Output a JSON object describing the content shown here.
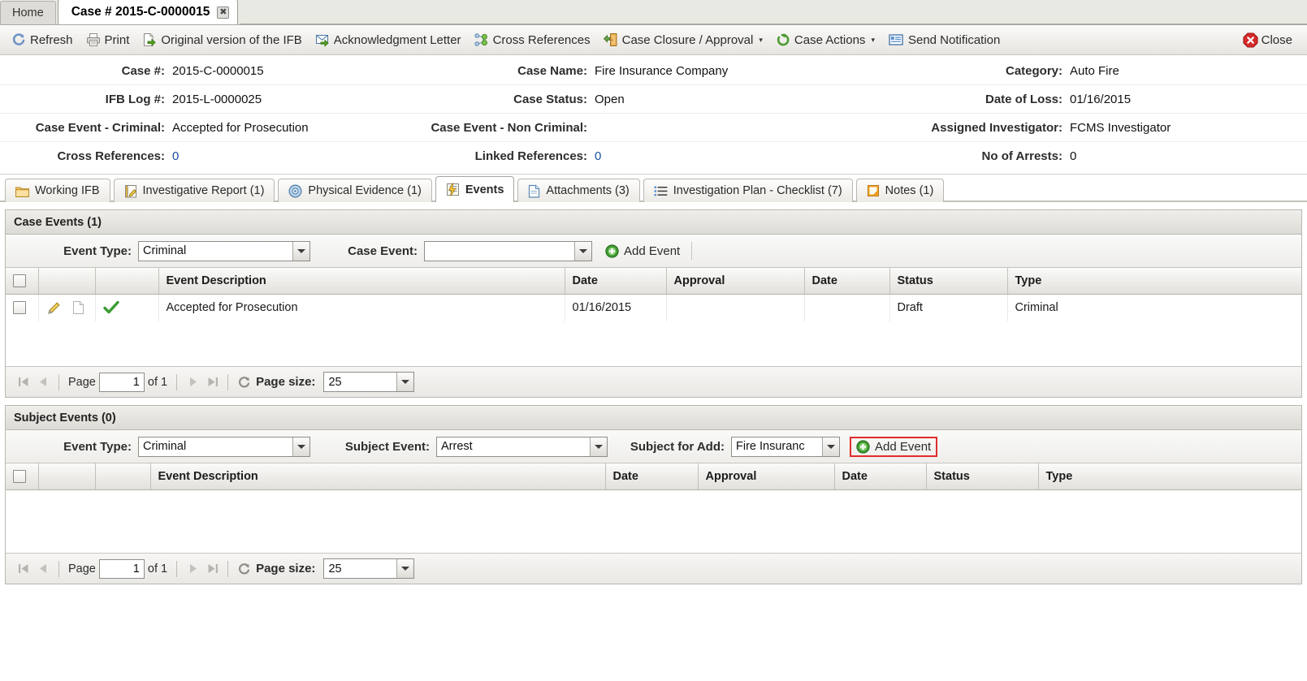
{
  "window_tabs": [
    {
      "label": "Home",
      "active": false,
      "closable": false
    },
    {
      "label": "Case # 2015-C-0000015",
      "active": true,
      "closable": true,
      "close_glyph": "✖"
    }
  ],
  "toolbar": {
    "items": [
      {
        "label": "Refresh",
        "icon": "refresh-icon"
      },
      {
        "label": "Print",
        "icon": "printer-icon"
      },
      {
        "label": "Original version of the IFB",
        "icon": "document-export-icon"
      },
      {
        "label": "Acknowledgment Letter",
        "icon": "envelope-export-icon"
      },
      {
        "label": "Cross References",
        "icon": "network-nodes-icon"
      },
      {
        "label": "Case Closure / Approval",
        "icon": "door-exit-icon",
        "dropdown": true
      },
      {
        "label": "Case Actions",
        "icon": "arrow-refresh-icon",
        "dropdown": true
      },
      {
        "label": "Send Notification",
        "icon": "notification-document-icon"
      }
    ],
    "close": {
      "label": "Close",
      "icon": "close-octagon-icon"
    },
    "caret_glyph": "▾"
  },
  "case_info": {
    "column1": [
      {
        "label": "Case #:",
        "value": "2015-C-0000015",
        "link": false
      },
      {
        "label": "IFB Log #:",
        "value": "2015-L-0000025",
        "link": false
      },
      {
        "label": "Case Event - Criminal:",
        "value": "Accepted for Prosecution",
        "link": false
      },
      {
        "label": "Cross References:",
        "value": "0",
        "link": true
      }
    ],
    "column2": [
      {
        "label": "Case Name:",
        "value": "Fire Insurance Company",
        "link": false
      },
      {
        "label": "Case Status:",
        "value": "Open",
        "link": false
      },
      {
        "label": "Case Event - Non Criminal:",
        "value": "",
        "link": false
      },
      {
        "label": "Linked References:",
        "value": "0",
        "link": true
      }
    ],
    "column3": [
      {
        "label": "Category:",
        "value": "Auto Fire",
        "link": false
      },
      {
        "label": "Date of Loss:",
        "value": "01/16/2015",
        "link": false
      },
      {
        "label": "Assigned Investigator:",
        "value": "FCMS Investigator",
        "link": false
      },
      {
        "label": "No of Arrests:",
        "value": "0",
        "link": false
      }
    ]
  },
  "section_tabs": [
    {
      "label": "Working IFB",
      "icon": "folder-icon",
      "active": false
    },
    {
      "label": "Investigative Report (1)",
      "icon": "notepad-pencil-icon",
      "active": false
    },
    {
      "label": "Physical Evidence (1)",
      "icon": "disc-icon",
      "active": false
    },
    {
      "label": "Events",
      "icon": "events-lightning-icon",
      "active": true
    },
    {
      "label": "Attachments (3)",
      "icon": "page-icon",
      "active": false
    },
    {
      "label": "Investigation Plan - Checklist (7)",
      "icon": "checklist-icon",
      "active": false
    },
    {
      "label": "Notes (1)",
      "icon": "note-icon",
      "active": false
    }
  ],
  "case_events": {
    "header": "Case Events (1)",
    "filters": {
      "event_type_label": "Event Type:",
      "event_type_value": "Criminal",
      "case_event_label": "Case Event:",
      "case_event_value": "",
      "add_event_label": "Add Event",
      "add_event_icon": "add-circle-icon",
      "highlighted": false
    },
    "columns": [
      "",
      "",
      "",
      "Event Description",
      "Date",
      "Approval",
      "Date",
      "Status",
      "Type"
    ],
    "rows": [
      {
        "checked": false,
        "icons": [
          "edit-pencil-icon",
          "page-icon",
          "green-check-icon"
        ],
        "event_description": "Accepted for Prosecution",
        "date": "01/16/2015",
        "approval": "",
        "approval_date": "",
        "status": "Draft",
        "type": "Criminal"
      }
    ],
    "pager": {
      "page_label": "Page",
      "page_value": "1",
      "of_label": "of 1",
      "page_size_label": "Page size:",
      "page_size_value": "25",
      "first_icon": "first-page-icon",
      "prev_icon": "prev-page-icon",
      "next_icon": "next-page-icon",
      "last_icon": "last-page-icon",
      "refresh_icon": "refresh-pager-icon"
    }
  },
  "subject_events": {
    "header": "Subject Events (0)",
    "filters": {
      "event_type_label": "Event Type:",
      "event_type_value": "Criminal",
      "subject_event_label": "Subject Event:",
      "subject_event_value": "Arrest",
      "subject_for_add_label": "Subject for Add:",
      "subject_for_add_value": "Fire Insuranc",
      "add_event_label": "Add Event",
      "add_event_icon": "add-circle-icon",
      "highlighted": true
    },
    "columns": [
      "",
      "",
      "",
      "Event Description",
      "Date",
      "Approval",
      "Date",
      "Status",
      "Type"
    ],
    "rows": [],
    "pager": {
      "page_label": "Page",
      "page_value": "1",
      "of_label": "of 1",
      "page_size_label": "Page size:",
      "page_size_value": "25",
      "first_icon": "first-page-icon",
      "prev_icon": "prev-page-icon",
      "next_icon": "next-page-icon",
      "last_icon": "last-page-icon",
      "refresh_icon": "refresh-pager-icon"
    }
  },
  "colors": {
    "link": "#1a4fa0",
    "highlight_border": "#e02d2d",
    "close_red": "#d52b2b",
    "green": "#3c9a33",
    "toolbar_bg": "#eeedea"
  }
}
